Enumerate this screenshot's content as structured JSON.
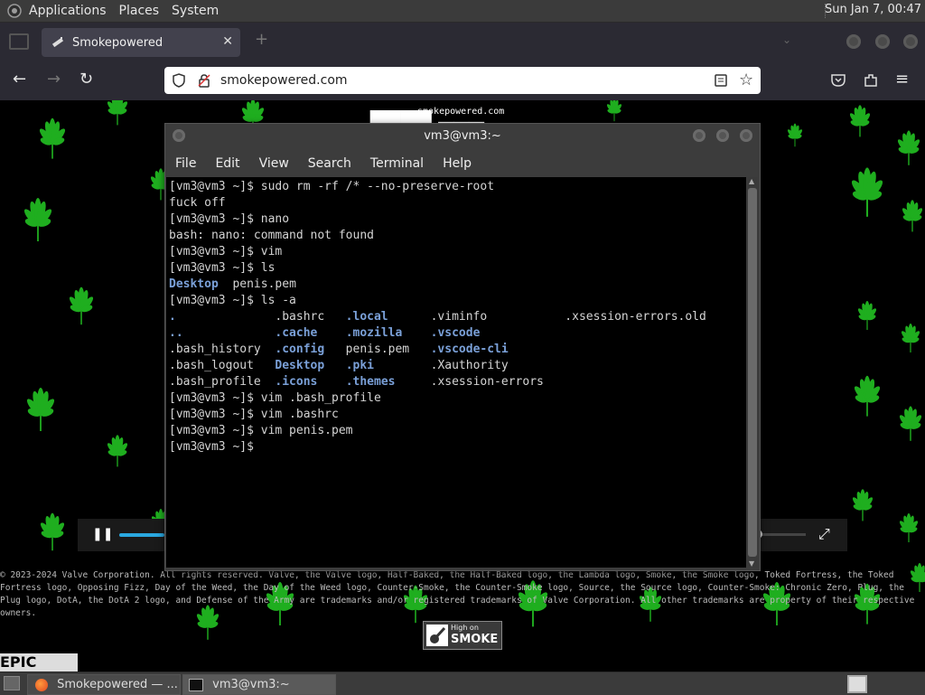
{
  "panel": {
    "menus": [
      "Applications",
      "Places",
      "System"
    ],
    "clock": "Sun Jan  7, 00:47"
  },
  "browser": {
    "tab_title": "Smokepowered",
    "url": "smokepowered.com"
  },
  "page": {
    "header_text": "smokepowered.com",
    "copyright": "© 2023-2024 Valve Corporation. All rights reserved. Valve, the Valve logo, Half-Baked, the Half-Baked logo, the Lambda logo, Smoke, the Smoke logo, Toked Fortress, the Toked Fortress logo, Opposing Fizz, Day of the Weed, the Day of the Weed logo, Counter-Smoke, the Counter-Smoke logo, Source, the Source logo, Counter-Smoke: Chronic Zero, Plug, the Plug logo, DotA, the DotA 2 logo, and Defense of the Army are trademarks and/or registered trademarks of Valve Corporation. All other trademarks are property of their respective owners.",
    "badge_line1": "High on",
    "badge_line2": "SMOKE",
    "epic_text": "EPIC"
  },
  "terminal": {
    "title": "vm3@vm3:~",
    "menu": [
      "File",
      "Edit",
      "View",
      "Search",
      "Terminal",
      "Help"
    ],
    "lines": [
      {
        "t": "[vm3@vm3 ~]$ sudo rm -rf /* --no-preserve-root"
      },
      {
        "t": "fuck off"
      },
      {
        "t": "[vm3@vm3 ~]$ nano"
      },
      {
        "t": "bash: nano: command not found"
      },
      {
        "t": "[vm3@vm3 ~]$ vim"
      },
      {
        "t": "[vm3@vm3 ~]$ ls"
      },
      {
        "parts": [
          {
            "t": "Desktop",
            "d": true
          },
          {
            "t": "  penis.pem"
          }
        ]
      },
      {
        "t": "[vm3@vm3 ~]$ ls -a"
      },
      {
        "parts": [
          {
            "t": ".",
            "d": true
          },
          {
            "t": "              .bashrc   "
          },
          {
            "t": ".local",
            "d": true
          },
          {
            "t": "      .viminfo           .xsession-errors.old"
          }
        ]
      },
      {
        "parts": [
          {
            "t": "..",
            "d": true
          },
          {
            "t": "             "
          },
          {
            "t": ".cache",
            "d": true
          },
          {
            "t": "    "
          },
          {
            "t": ".mozilla",
            "d": true
          },
          {
            "t": "    "
          },
          {
            "t": ".vscode",
            "d": true
          }
        ]
      },
      {
        "parts": [
          {
            "t": ".bash_history  "
          },
          {
            "t": ".config",
            "d": true
          },
          {
            "t": "   penis.pem   "
          },
          {
            "t": ".vscode-cli",
            "d": true
          }
        ]
      },
      {
        "parts": [
          {
            "t": ".bash_logout   "
          },
          {
            "t": "Desktop",
            "d": true
          },
          {
            "t": "   "
          },
          {
            "t": ".pki",
            "d": true
          },
          {
            "t": "        .Xauthority"
          }
        ]
      },
      {
        "parts": [
          {
            "t": ".bash_profile  "
          },
          {
            "t": ".icons",
            "d": true
          },
          {
            "t": "    "
          },
          {
            "t": ".themes",
            "d": true
          },
          {
            "t": "     .xsession-errors"
          }
        ]
      },
      {
        "t": "[vm3@vm3 ~]$ vim .bash_profile"
      },
      {
        "t": "[vm3@vm3 ~]$ vim .bashrc"
      },
      {
        "t": "[vm3@vm3 ~]$ vim penis.pem"
      },
      {
        "t": "[vm3@vm3 ~]$ "
      }
    ]
  },
  "taskbar": {
    "items": [
      "Smokepowered — ...",
      "vm3@vm3:~"
    ]
  },
  "colors": {
    "leaf": "#1fae1f",
    "dir": "#7aa0d8",
    "panel": "#3b3b3b"
  }
}
